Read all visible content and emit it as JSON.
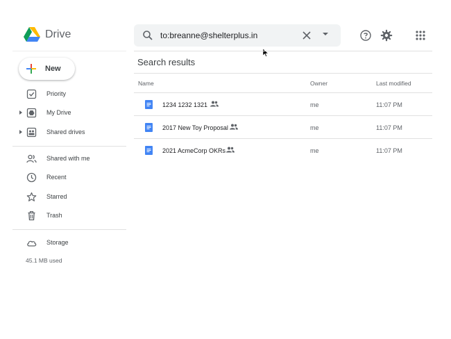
{
  "app": {
    "title": "Drive"
  },
  "search": {
    "value": "to:breanne@shelterplus.in"
  },
  "sidebar": {
    "new_label": "New",
    "items": [
      {
        "label": "Priority",
        "icon": "priority-icon"
      },
      {
        "label": "My Drive",
        "icon": "my-drive-icon"
      },
      {
        "label": "Shared drives",
        "icon": "shared-drives-icon"
      },
      {
        "label": "Shared with me",
        "icon": "shared-with-me-icon"
      },
      {
        "label": "Recent",
        "icon": "clock-icon"
      },
      {
        "label": "Starred",
        "icon": "star-icon"
      },
      {
        "label": "Trash",
        "icon": "trash-icon"
      },
      {
        "label": "Storage",
        "icon": "cloud-icon"
      }
    ],
    "storage_used": "45.1 MB used"
  },
  "main": {
    "title": "Search results",
    "columns": {
      "name": "Name",
      "owner": "Owner",
      "modified": "Last modified"
    },
    "rows": [
      {
        "name": "1234 1232 1321",
        "owner": "me",
        "modified": "11:07 PM"
      },
      {
        "name": "2017 New Toy Proposal",
        "owner": "me",
        "modified": "11:07 PM"
      },
      {
        "name": "2021 AcmeCorp OKRs",
        "owner": "me",
        "modified": "11:07 PM"
      }
    ]
  },
  "colors": {
    "doc_blue": "#4285f4",
    "icon_gray": "#5f6368",
    "divider": "#e0e0e0"
  }
}
